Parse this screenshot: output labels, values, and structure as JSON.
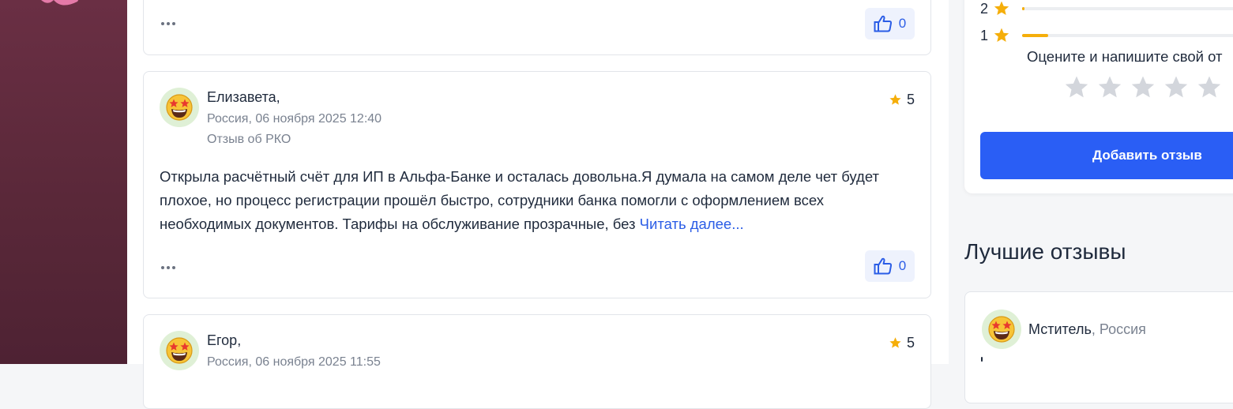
{
  "reviews": [
    {
      "likes": "0"
    },
    {
      "author": "Елизавета,",
      "meta": "Россия, 06 ноября 2025 12:40",
      "topic": "Отзыв об РКО",
      "rating": "5",
      "text": "Открыла расчётный счёт для ИП в Альфа-Банке и осталась довольна.Я думала на самом деле чет будет плохое, но процесс регистрации прошёл быстро, сотрудники банка помогли с оформлением всех необходимых документов. Тарифы на обслуживание прозрачные, без ",
      "read_more": "Читать далее...",
      "likes": "0"
    },
    {
      "author": "Егор,",
      "meta": "Россия, 06 ноября 2025 11:55",
      "rating": "5"
    }
  ],
  "rating_summary": {
    "distribution": [
      {
        "stars": "2",
        "fraction": 0.01
      },
      {
        "stars": "1",
        "fraction": 0.11
      }
    ],
    "prompt": "Оцените и напишите свой от",
    "add_button": "Добавить отзыв"
  },
  "best_reviews": {
    "title": "Лучшие отзывы",
    "items": [
      {
        "author": "Мститель",
        "country": "Россия"
      }
    ]
  },
  "colors": {
    "accent": "#2a5ef5",
    "star": "#f5ae0a",
    "star_empty": "#d3d6dc",
    "sidebar": "#5e2a3d"
  }
}
